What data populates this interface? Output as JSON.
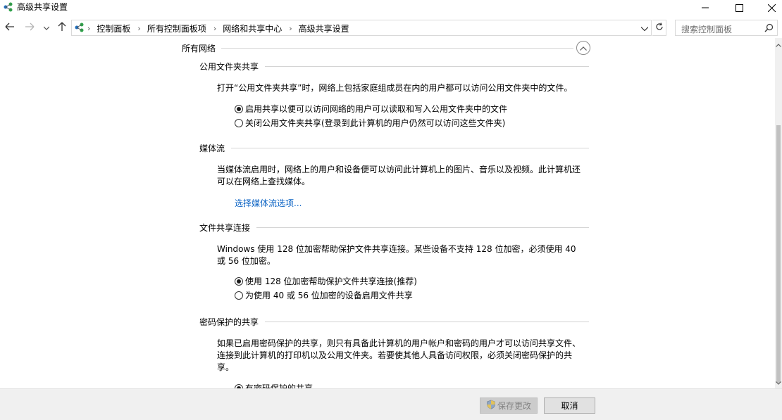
{
  "window": {
    "title": "高级共享设置",
    "minimize_icon": "minimize-icon",
    "maximize_icon": "maximize-icon",
    "close_icon": "close-icon"
  },
  "nav": {
    "breadcrumbs": [
      "控制面板",
      "所有控制面板项",
      "网络和共享中心",
      "高级共享设置"
    ],
    "search_placeholder": "搜索控制面板"
  },
  "content": {
    "group_title": "所有网络",
    "sections": {
      "public_folder": {
        "title": "公用文件夹共享",
        "description": "打开“公用文件夹共享”时，网络上包括家庭组成员在内的用户都可以访问公用文件夹中的文件。",
        "options": [
          {
            "label": "启用共享以便可以访问网络的用户可以读取和写入公用文件夹中的文件",
            "checked": true
          },
          {
            "label": "关闭公用文件夹共享(登录到此计算机的用户仍然可以访问这些文件夹)",
            "checked": false
          }
        ]
      },
      "media": {
        "title": "媒体流",
        "description": "当媒体流启用时，网络上的用户和设备便可以访问此计算机上的图片、音乐以及视频。此计算机还可以在网络上查找媒体。",
        "link": "选择媒体流选项..."
      },
      "file_sharing": {
        "title": "文件共享连接",
        "description": "Windows 使用 128 位加密帮助保护文件共享连接。某些设备不支持 128 位加密，必须使用 40 或 56 位加密。",
        "options": [
          {
            "label": "使用 128 位加密帮助保护文件共享连接(推荐)",
            "checked": true
          },
          {
            "label": "为使用 40 或 56 位加密的设备启用文件共享",
            "checked": false
          }
        ]
      },
      "password": {
        "title": "密码保护的共享",
        "description": "如果已启用密码保护的共享，则只有具备此计算机的用户帐户和密码的用户才可以访问共享文件、连接到此计算机的打印机以及公用文件夹。若要使其他人具备访问权限，必须关闭密码保护的共享。",
        "options": [
          {
            "label": "有密码保护的共享",
            "checked": true
          }
        ]
      }
    }
  },
  "footer": {
    "save_label": "保存更改",
    "cancel_label": "取消"
  },
  "colors": {
    "link": "#0b63c4",
    "footer_bg": "#f0f0f0"
  }
}
